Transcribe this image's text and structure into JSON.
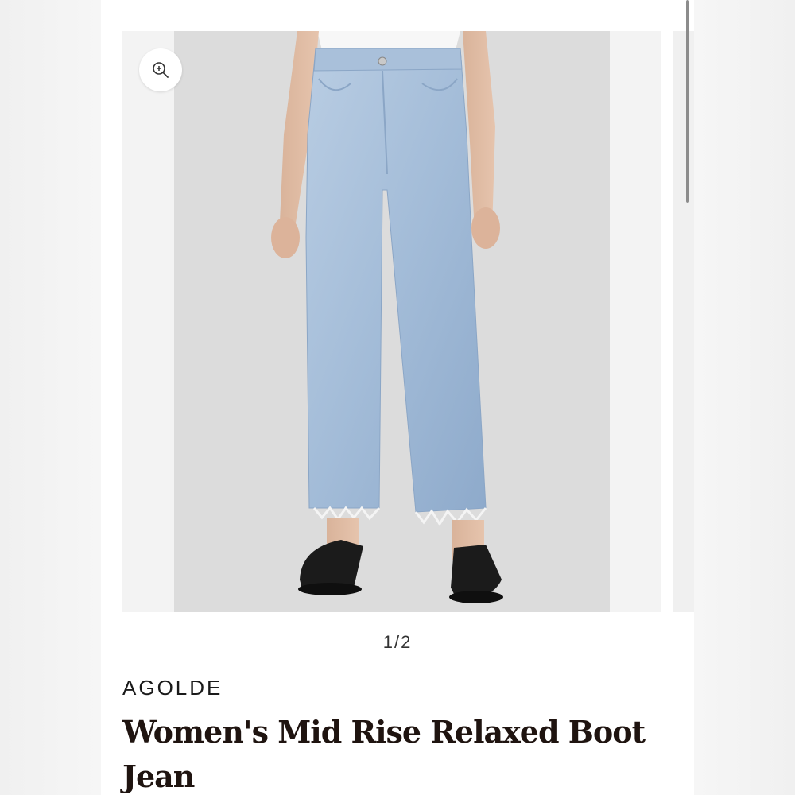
{
  "gallery": {
    "current": "1",
    "total": "2",
    "separator": "/",
    "zoom_icon": "zoom-in-icon",
    "photo_description_icon": "product-photo"
  },
  "product": {
    "brand": "AGOLDE",
    "title": "Women's Mid Rise Relaxed Boot Jean"
  },
  "colors": {
    "background": "#ffffff",
    "photo_bg": "#dcdcdc",
    "title_text": "#1f1410"
  }
}
